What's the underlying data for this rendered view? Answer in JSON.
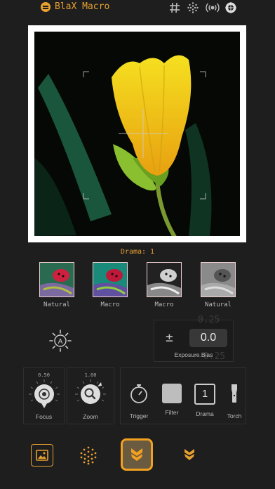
{
  "header": {
    "title": "BlaX Macro",
    "icons": [
      "hash-icon",
      "dots-grid-icon",
      "broadcast-icon",
      "aperture-icon"
    ]
  },
  "drama": {
    "label": "Drama: 1"
  },
  "presets": [
    {
      "label": "Natural",
      "style": "color"
    },
    {
      "label": "Macro",
      "style": "teal"
    },
    {
      "label": "Macro",
      "style": "mono-dark"
    },
    {
      "label": "Natural",
      "style": "mono"
    }
  ],
  "exposure": {
    "ghost_top": "0.25",
    "value": "0.0",
    "ghost_bottom": "-0.25",
    "pm": "±",
    "label": "Exposure Bias"
  },
  "focus": {
    "value": "0.50",
    "label": "Focus"
  },
  "zoom": {
    "value": "1.00",
    "label": "Zoom"
  },
  "controls": {
    "trigger": "Trigger",
    "filter": "Filter",
    "drama": "Drama",
    "drama_value": "1",
    "torch": "Torch"
  },
  "colors": {
    "accent": "#e8a030",
    "background": "#1e1e1e"
  }
}
